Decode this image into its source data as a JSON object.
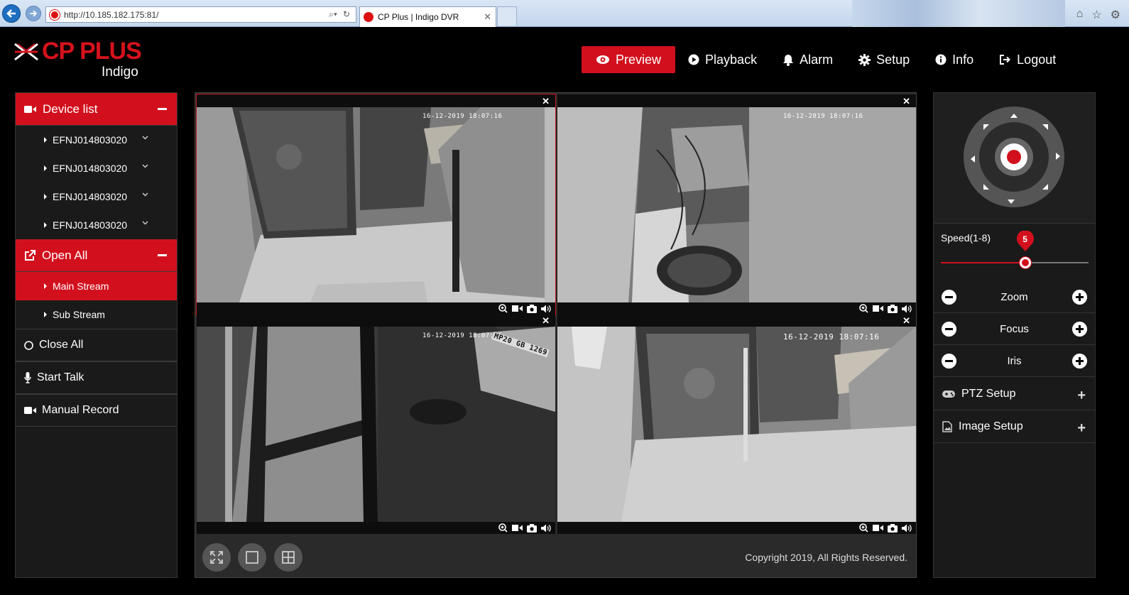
{
  "browser": {
    "url": "http://10.185.182.175:81/",
    "tab_title": "CP Plus | Indigo DVR"
  },
  "brand": {
    "name": "CP PLUS",
    "product": "Indigo"
  },
  "nav": {
    "items": [
      {
        "label": "Preview",
        "icon": "eye-icon",
        "active": true
      },
      {
        "label": "Playback",
        "icon": "play-circle-icon"
      },
      {
        "label": "Alarm",
        "icon": "bell-icon"
      },
      {
        "label": "Setup",
        "icon": "gear-icon"
      },
      {
        "label": "Info",
        "icon": "info-icon"
      },
      {
        "label": "Logout",
        "icon": "logout-icon"
      }
    ]
  },
  "sidebar": {
    "device_list_label": "Device list",
    "devices": [
      "EFNJ014803020",
      "EFNJ014803020",
      "EFNJ014803020",
      "EFNJ014803020"
    ],
    "open_all_label": "Open All",
    "streams": [
      "Main Stream",
      "Sub Stream"
    ],
    "close_all_label": "Close All",
    "start_talk_label": "Start Talk",
    "manual_record_label": "Manual Record"
  },
  "cameras": [
    {
      "timestamp": "16-12-2019 18:07:16"
    },
    {
      "timestamp": "16-12-2019 18:07:16"
    },
    {
      "timestamp": "16-12-2019 18:07:16",
      "overlay_label": "MP20 GB 1269"
    },
    {
      "timestamp": "16-12-2019 18:07:16"
    }
  ],
  "footer": {
    "copyright": "Copyright 2019, All Rights Reserved."
  },
  "ptz": {
    "speed_label": "Speed(1-8)",
    "speed_value": "5",
    "speed_fraction": 0.57,
    "zoom_label": "Zoom",
    "focus_label": "Focus",
    "iris_label": "Iris",
    "ptz_setup_label": "PTZ Setup",
    "image_setup_label": "Image Setup"
  },
  "colors": {
    "accent": "#d2101d",
    "panel": "#1a1a1a"
  }
}
